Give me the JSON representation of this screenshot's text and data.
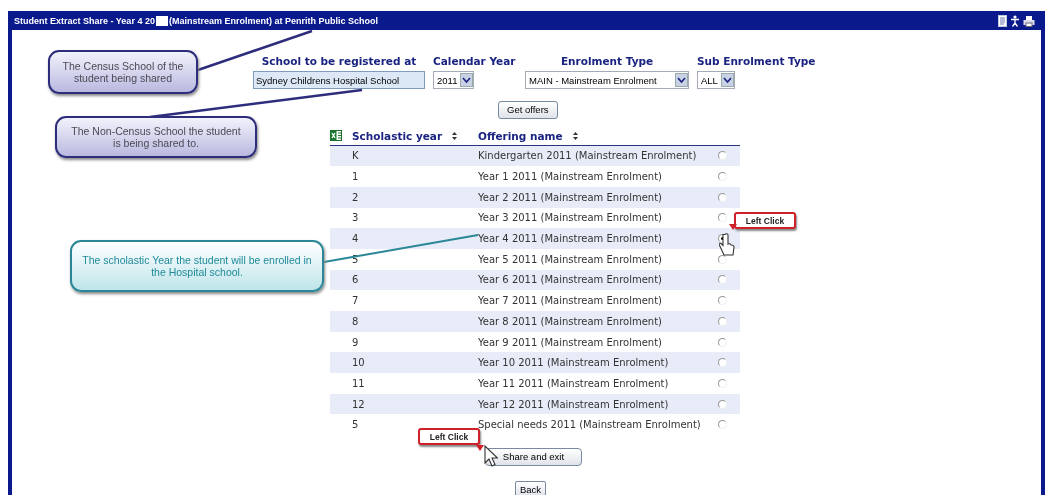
{
  "window": {
    "title_start": "Student Extract Share - Year 4 20",
    "title_end": "(Mainstream Enrolment) at Penrith Public School"
  },
  "form": {
    "fields": [
      {
        "label": "School to be registered at",
        "kind": "text",
        "value": "Sydney Childrens Hospital School"
      },
      {
        "label": "Calendar Year",
        "kind": "select",
        "value": "2011"
      },
      {
        "label": "Enrolment Type",
        "kind": "select",
        "value": "MAIN - Mainstream Enrolment"
      },
      {
        "label": "Sub Enrolment Type",
        "kind": "select",
        "value": "ALL"
      }
    ]
  },
  "get_offers_button": "Get offers",
  "table": {
    "columns": [
      "Scholastic year",
      "Offering name"
    ],
    "rows": [
      {
        "scholastic_year": "K",
        "offering_name": "Kindergarten 2011 (Mainstream Enrolment)",
        "selected": false
      },
      {
        "scholastic_year": "1",
        "offering_name": "Year 1 2011 (Mainstream Enrolment)",
        "selected": false
      },
      {
        "scholastic_year": "2",
        "offering_name": "Year 2 2011 (Mainstream Enrolment)",
        "selected": false
      },
      {
        "scholastic_year": "3",
        "offering_name": "Year 3 2011 (Mainstream Enrolment)",
        "selected": false
      },
      {
        "scholastic_year": "4",
        "offering_name": "Year 4 2011 (Mainstream Enrolment)",
        "selected": true
      },
      {
        "scholastic_year": "5",
        "offering_name": "Year 5 2011 (Mainstream Enrolment)",
        "selected": false
      },
      {
        "scholastic_year": "6",
        "offering_name": "Year 6 2011 (Mainstream Enrolment)",
        "selected": false
      },
      {
        "scholastic_year": "7",
        "offering_name": "Year 7 2011 (Mainstream Enrolment)",
        "selected": false
      },
      {
        "scholastic_year": "8",
        "offering_name": "Year 8 2011 (Mainstream Enrolment)",
        "selected": false
      },
      {
        "scholastic_year": "9",
        "offering_name": "Year 9 2011 (Mainstream Enrolment)",
        "selected": false
      },
      {
        "scholastic_year": "10",
        "offering_name": "Year 10 2011 (Mainstream Enrolment)",
        "selected": false
      },
      {
        "scholastic_year": "11",
        "offering_name": "Year 11 2011 (Mainstream Enrolment)",
        "selected": false
      },
      {
        "scholastic_year": "12",
        "offering_name": "Year 12 2011 (Mainstream Enrolment)",
        "selected": false
      },
      {
        "scholastic_year": "5",
        "offering_name": "Special needs 2011 (Mainstream Enrolment)",
        "selected": false
      }
    ]
  },
  "share_button": "Share and exit",
  "back_button": "Back",
  "callouts": [
    {
      "kind": "note",
      "text": "The Census School of the student being shared"
    },
    {
      "kind": "note",
      "text": "The Non-Census School the student is being shared to."
    },
    {
      "kind": "teal_note",
      "text": "The scholastic Year the student will be enrolled in the Hospital school."
    },
    {
      "kind": "click",
      "text": "Left Click"
    },
    {
      "kind": "click",
      "text": "Left Click"
    }
  ]
}
